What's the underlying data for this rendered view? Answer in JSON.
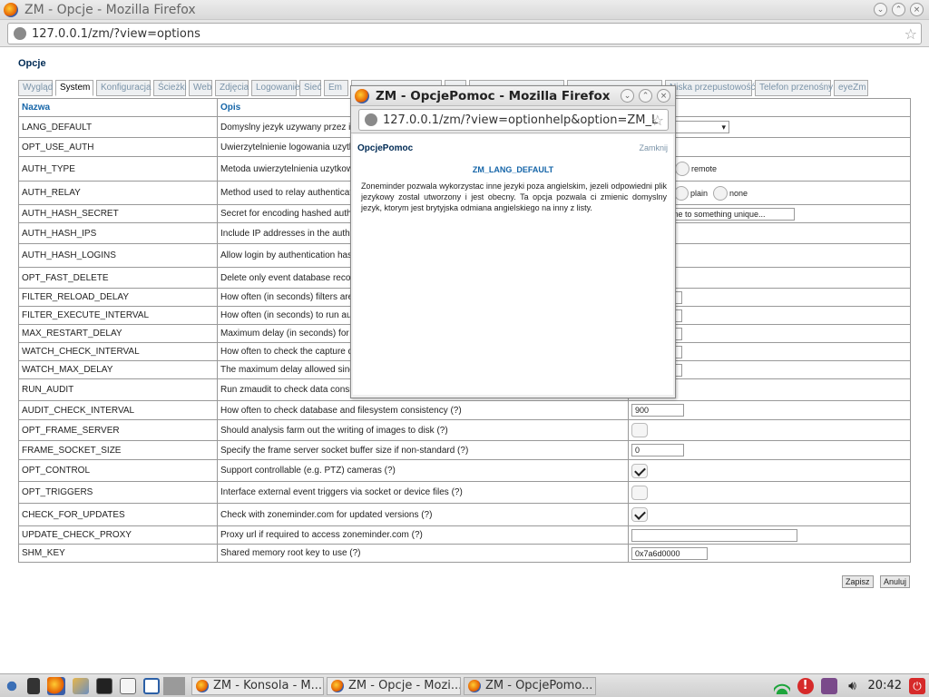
{
  "window": {
    "title": "ZM - Opcje - Mozilla Firefox",
    "url": "127.0.0.1/zm/?view=options"
  },
  "page": {
    "title": "Opcje"
  },
  "tabs": [
    {
      "label": "Wygląd"
    },
    {
      "label": "System"
    },
    {
      "label": "Konfiguracja"
    },
    {
      "label": "Ścieżki"
    },
    {
      "label": "Web"
    },
    {
      "label": "Zdjęcia"
    },
    {
      "label": "Logowanie"
    },
    {
      "label": "Sieć"
    },
    {
      "label": "Em"
    },
    {
      "label": ""
    },
    {
      "label": ""
    },
    {
      "label": ""
    },
    {
      "label": ""
    },
    {
      "label": "Niska przepustowość"
    },
    {
      "label": "Telefon przenośny"
    },
    {
      "label": "eyeZm"
    }
  ],
  "table": {
    "headers": [
      "Nazwa",
      "Opis",
      ""
    ],
    "rows": [
      {
        "name": "LANG_DEFAULT",
        "desc": "Domyslny jezyk uzywany przez in"
      },
      {
        "name": "OPT_USE_AUTH",
        "desc": "Uwierzytelnienie logowania uzytko"
      },
      {
        "name": "AUTH_TYPE",
        "desc": "Metoda uwierzytelnienia uzytkowni",
        "radio": [
          "remote"
        ]
      },
      {
        "name": "AUTH_RELAY",
        "desc": "Method used to relay authenticatio",
        "radio": [
          "d",
          "plain",
          "none"
        ]
      },
      {
        "name": "AUTH_HASH_SECRET",
        "desc": "Secret for encoding hashed authe",
        "value": "me to something unique..."
      },
      {
        "name": "AUTH_HASH_IPS",
        "desc": "Include IP addresses in the authe"
      },
      {
        "name": "AUTH_HASH_LOGINS",
        "desc": "Allow login by authentication hash"
      },
      {
        "name": "OPT_FAST_DELETE",
        "desc": "Delete only event database record"
      },
      {
        "name": "FILTER_RELOAD_DELAY",
        "desc": "How often (in seconds) filters are"
      },
      {
        "name": "FILTER_EXECUTE_INTERVAL",
        "desc": "How often (in seconds) to run auto"
      },
      {
        "name": "MAX_RESTART_DELAY",
        "desc": "Maximum delay (in seconds) for d"
      },
      {
        "name": "WATCH_CHECK_INTERVAL",
        "desc": "How often to check the capture da"
      },
      {
        "name": "WATCH_MAX_DELAY",
        "desc": "The maximum delay allowed since"
      },
      {
        "name": "RUN_AUDIT",
        "desc": "Run zmaudit to check data consis"
      },
      {
        "name": "AUDIT_CHECK_INTERVAL",
        "desc": "How often to check database and filesystem consistency (?)",
        "value": "900"
      },
      {
        "name": "OPT_FRAME_SERVER",
        "desc": "Should analysis farm out the writing of images to disk (?)",
        "checked": false
      },
      {
        "name": "FRAME_SOCKET_SIZE",
        "desc": "Specify the frame server socket buffer size if non-standard (?)",
        "value": "0"
      },
      {
        "name": "OPT_CONTROL",
        "desc": "Support controllable (e.g. PTZ) cameras (?)",
        "checked": true
      },
      {
        "name": "OPT_TRIGGERS",
        "desc": "Interface external event triggers via socket or device files (?)",
        "checked": false
      },
      {
        "name": "CHECK_FOR_UPDATES",
        "desc": "Check with zoneminder.com for updated versions (?)",
        "checked": true
      },
      {
        "name": "UPDATE_CHECK_PROXY",
        "desc": "Proxy url if required to access zoneminder.com (?)",
        "value": ""
      },
      {
        "name": "SHM_KEY",
        "desc": "Shared memory root key to use (?)",
        "value": "0x7a6d0000"
      }
    ]
  },
  "buttons": {
    "save": "Zapisz",
    "cancel": "Anuluj"
  },
  "popup": {
    "title": "ZM - OpcjePomoc - Mozilla Firefox",
    "url": "127.0.0.1/zm/?view=optionhelp&option=ZM_L",
    "heading": "OpcjePomoc",
    "close": "Zamknij",
    "option": "ZM_LANG_DEFAULT",
    "text": "Zoneminder pozwala wykorzystac inne jezyki poza angielskim, jezeli odpowiedni plik jezykowy zostal utworzony i jest obecny. Ta opcja pozwala ci zmienic domyslny jezyk, ktorym jest brytyjska odmiana angielskiego na inny z listy."
  },
  "taskbar": {
    "tasks": [
      {
        "label": "ZM - Konsola - M..."
      },
      {
        "label": "ZM - Opcje - Mozi..."
      },
      {
        "label": "ZM - OpcjePomo..."
      }
    ],
    "clock": "20:42"
  }
}
